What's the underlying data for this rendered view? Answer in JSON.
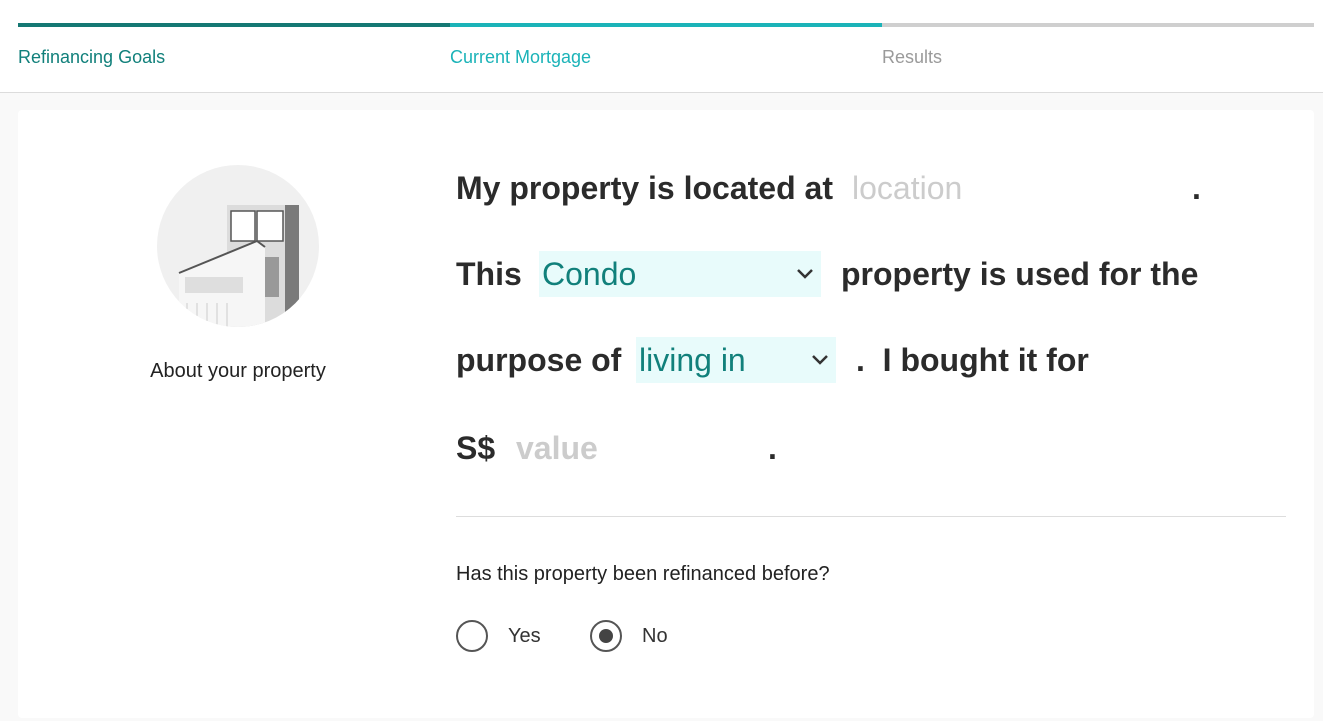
{
  "progress": {
    "steps": [
      {
        "label": "Refinancing Goals",
        "color": "#11807b",
        "bar_color": "#157873"
      },
      {
        "label": "Current Mortgage",
        "color": "#1bb3b8",
        "bar_color": "#1bb3b8"
      },
      {
        "label": "Results",
        "color": "#9a9a9a",
        "bar_color": "#cfcfcf"
      }
    ]
  },
  "sidebar": {
    "icon": "building-icon",
    "caption": "About your property"
  },
  "form": {
    "line1_prefix": "My property is located at",
    "location_placeholder": "location",
    "line1_suffix": ".",
    "line2_prefix": "This",
    "property_type": "Condo",
    "line2_suffix": "property is used for the",
    "line3_prefix": "purpose of",
    "purpose": "living in",
    "line3_suffix": ".  I bought it for",
    "currency": "S$",
    "value_placeholder": "value",
    "line4_suffix": "."
  },
  "refinanced": {
    "question": "Has this property been refinanced before?",
    "options": [
      "Yes",
      "No"
    ],
    "selected": "No"
  }
}
